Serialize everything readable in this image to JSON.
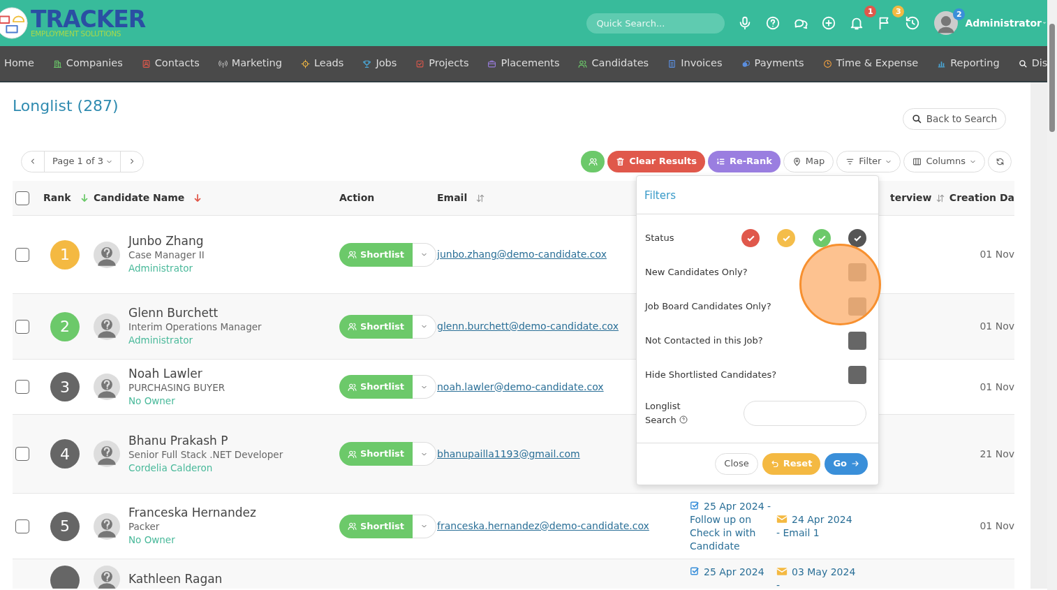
{
  "brand": {
    "name": "TRACKER",
    "tagline": "EMPLOYMENT SOLUTIONS"
  },
  "header": {
    "search": {
      "placeholder": "Quick Search..."
    },
    "notifications": "1",
    "flags": "3",
    "user_badge": "2",
    "user": "Administrator"
  },
  "nav": [
    {
      "label": "Home"
    },
    {
      "label": "Companies"
    },
    {
      "label": "Contacts"
    },
    {
      "label": "Marketing"
    },
    {
      "label": "Leads"
    },
    {
      "label": "Jobs"
    },
    {
      "label": "Projects"
    },
    {
      "label": "Placements"
    },
    {
      "label": "Candidates"
    },
    {
      "label": "Invoices"
    },
    {
      "label": "Payments"
    },
    {
      "label": "Time & Expense"
    },
    {
      "label": "Reporting"
    },
    {
      "label": "Dis"
    }
  ],
  "page": {
    "title": "Longlist (287)",
    "back_button": "Back to Search",
    "pager": "Page 1 of 3"
  },
  "toolbar": [
    {
      "kind": "icon",
      "color": "#6cc96a"
    },
    {
      "kind": "text",
      "label": "Clear Results",
      "color": "#e0584b"
    },
    {
      "kind": "text",
      "label": "Re-Rank",
      "color": "#9a7ee0"
    },
    {
      "kind": "text",
      "label": "Map"
    },
    {
      "kind": "text",
      "label": "Filter",
      "dropdown": true
    },
    {
      "kind": "text",
      "label": "Columns",
      "dropdown": true
    },
    {
      "kind": "icon"
    }
  ],
  "table": {
    "select_all_checked": false,
    "columns": [
      {
        "label": "Rank",
        "kind": "sorted",
        "color": "#6cc96a"
      },
      {
        "label": "Candidate Name",
        "kind": "sorted",
        "color": "#e0584b"
      },
      {
        "label": "Action",
        "kind": "plain"
      },
      {
        "label": "Email",
        "kind": "sortable"
      },
      {
        "kind": "plain"
      },
      {
        "kind": "plain"
      },
      {
        "label": "terview",
        "kind": "sortable"
      },
      {
        "label": "Creation Da",
        "kind": "plain"
      }
    ],
    "rows": [
      {
        "rank": "1",
        "color": "#f4b942",
        "name": "Junbo Zhang",
        "title": "Case Manager II",
        "owner": "Administrator",
        "action": "Shortlist",
        "email": "junbo.zhang@demo-candidate.cox",
        "date": "01 Nov",
        "checked": false
      },
      {
        "rank": "2",
        "color": "#6cc96a",
        "name": "Glenn Burchett",
        "title": "Interim Operations Manager",
        "owner": "Administrator",
        "action": "Shortlist",
        "email": "glenn.burchett@demo-candidate.cox",
        "date": "01 Nov",
        "checked": false
      },
      {
        "rank": "3",
        "color": "#666666",
        "name": "Noah Lawler",
        "title": "PURCHASING BUYER",
        "owner": "No Owner",
        "action": "Shortlist",
        "email": "noah.lawler@demo-candidate.cox",
        "date": "01 Nov",
        "checked": false
      },
      {
        "rank": "4",
        "color": "#666666",
        "name": "Bhanu Prakash P",
        "title": "Senior Full Stack .NET Developer",
        "owner": "Cordelia Calderon",
        "action": "Shortlist",
        "email": "bhanupailla1193@gmail.com",
        "date": "21 Nov",
        "checked": false
      },
      {
        "rank": "5",
        "color": "#666666",
        "name": "Franceska Hernandez",
        "title": "Packer",
        "owner": "No Owner",
        "action": "Shortlist",
        "email": "franceska.hernandez@demo-candidate.cox",
        "tasks": [
          "25 Apr 2024 - Follow up on Check in with Candidate"
        ],
        "messages": [
          "24 Apr 2024 - Email 1"
        ],
        "date": "01 Nov",
        "checked": false
      },
      {
        "color": "#666666",
        "name": "Kathleen Ragan",
        "tasks": [
          "25 Apr 2024"
        ],
        "messages": [
          "03 May 2024 -"
        ]
      }
    ]
  },
  "filters": {
    "title": "Filters",
    "status_label": "Status",
    "statuses": [
      {
        "color": "#e0584b",
        "checked": true
      },
      {
        "color": "#f4bd4a",
        "checked": true
      },
      {
        "color": "#6cc96a",
        "checked": true
      },
      {
        "color": "#555555",
        "checked": true
      }
    ],
    "toggles": [
      {
        "label": "New Candidates Only?",
        "checked": false
      },
      {
        "label": "Job Board Candidates Only?",
        "checked": false
      },
      {
        "label": "Not Contacted in this Job?",
        "checked": false
      },
      {
        "label": "Hide Shortlisted Candidates?",
        "checked": false
      }
    ],
    "search_label": "Longlist Search",
    "buttons": [
      {
        "kind": "close",
        "label": "Close"
      },
      {
        "kind": "reset",
        "label": "Reset"
      },
      {
        "kind": "go",
        "label": "Go"
      }
    ]
  },
  "click_highlight": true
}
